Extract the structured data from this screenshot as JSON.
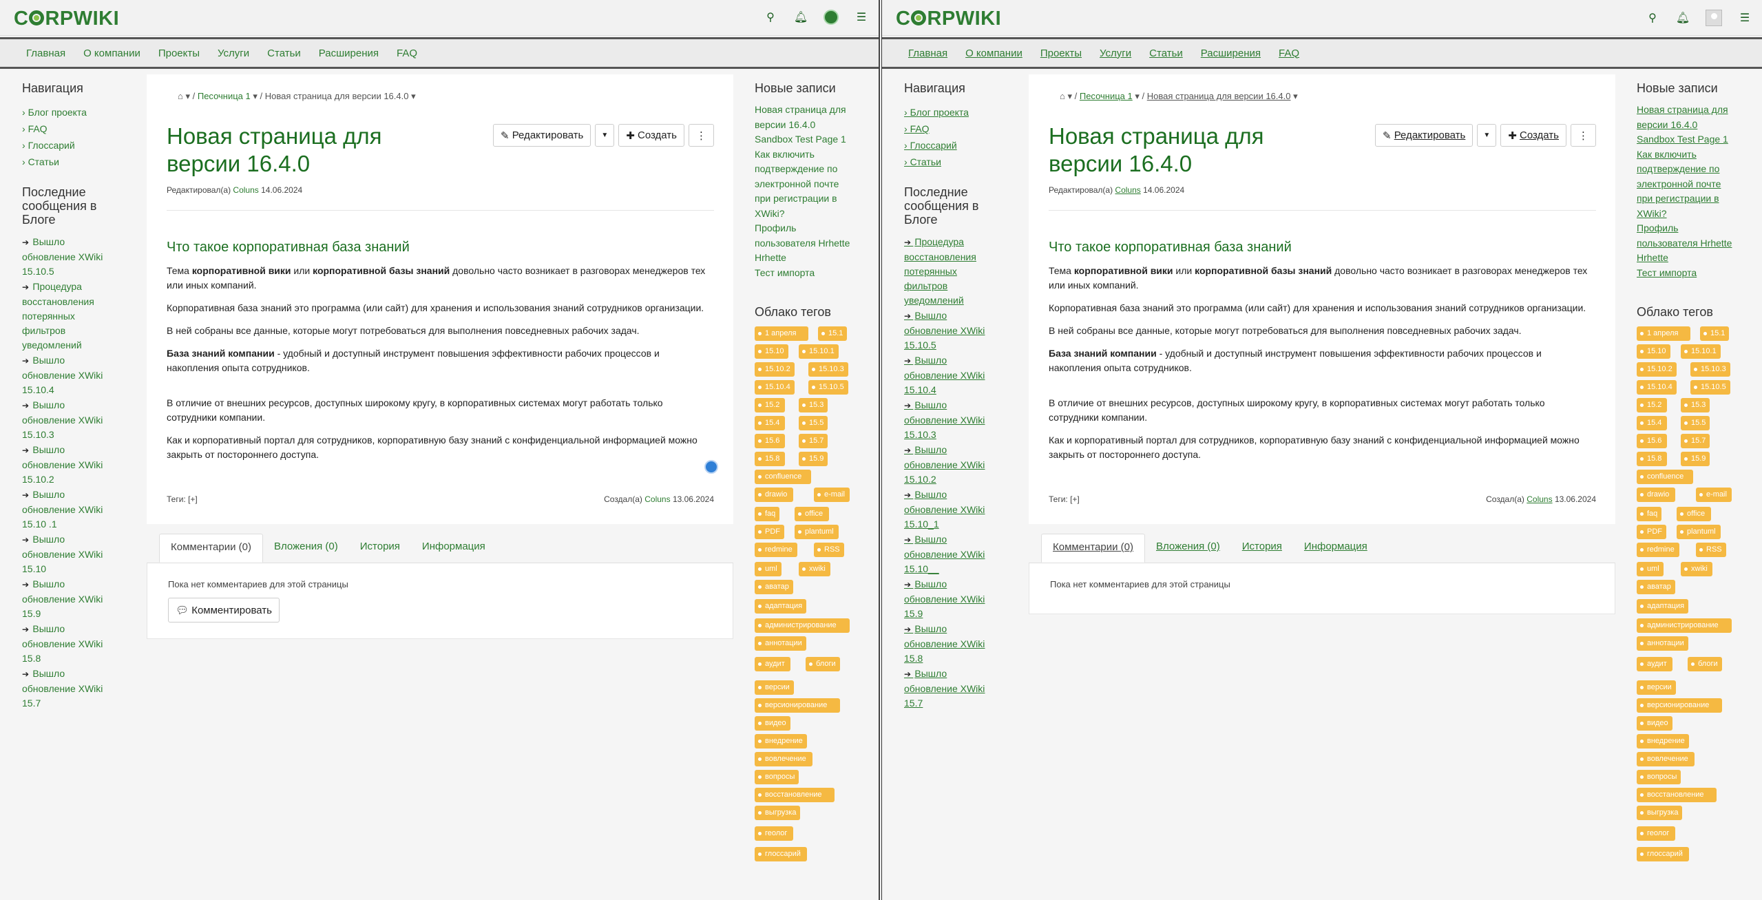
{
  "app": {
    "logo": "CORPWIKI"
  },
  "menu": [
    "Главная",
    "О компании",
    "Проекты",
    "Услуги",
    "Статьи",
    "Расширения",
    "FAQ"
  ],
  "navigation": {
    "title": "Навигация",
    "items": [
      "Блог проекта",
      "FAQ",
      "Глоссарий",
      "Статьи"
    ]
  },
  "blog": {
    "title": "Последние сообщения в Блоге",
    "left_items": [
      [
        "Вышло",
        "обновление XWiki",
        "15.10.5"
      ],
      [
        "Процедура",
        "восстановления",
        "потерянных",
        "фильтров",
        "уведомлений"
      ],
      [
        "Вышло",
        "обновление XWiki",
        "15.10.4"
      ],
      [
        "Вышло",
        "обновление XWiki",
        "15.10.3"
      ],
      [
        "Вышло",
        "обновление XWiki",
        "15.10.2"
      ],
      [
        "Вышло",
        "обновление XWiki",
        "15.10 .1"
      ],
      [
        "Вышло",
        "обновление XWiki",
        "15.10"
      ],
      [
        "Вышло",
        "обновление XWiki",
        "15.9"
      ],
      [
        "Вышло",
        "обновление XWiki",
        "15.8"
      ],
      [
        "Вышло",
        "обновление XWiki",
        "15.7"
      ]
    ],
    "right_items": [
      [
        "Процедура",
        "восстановления",
        "потерянных",
        "фильтров",
        "уведомлений"
      ],
      [
        "Вышло",
        "обновление XWiki",
        "15.10.5"
      ],
      [
        "Вышло",
        "обновление XWiki",
        "15.10.4"
      ],
      [
        "Вышло",
        "обновление XWiki",
        "15.10.3"
      ],
      [
        "Вышло",
        "обновление XWiki",
        "15.10.2"
      ],
      [
        "Вышло",
        "обновление XWiki",
        "15.10_1"
      ],
      [
        "Вышло",
        "обновление XWiki",
        "15.10__"
      ],
      [
        "Вышло",
        "обновление XWiki",
        "15.9"
      ],
      [
        "Вышло",
        "обновление XWiki",
        "15.8"
      ],
      [
        "Вышло",
        "обновление XWiki",
        "15.7"
      ]
    ]
  },
  "breadcrumb": {
    "sandbox": "Песочница 1",
    "current": "Новая страница для версии 16.4.0"
  },
  "page": {
    "title_line1": "Новая страница для",
    "title_line2": "версии 16.4.0",
    "edit_label": "Редактировать",
    "create_label": "Создать",
    "edited_by_prefix": "Редактировал(а)",
    "edited_by_user": "Coluns",
    "edited_date": "14.06.2024",
    "heading": "Что такое корпоративная база знаний",
    "p1_a": "Тема ",
    "p1_b": "корпоративной вики",
    "p1_c": " или ",
    "p1_d": "корпоративной базы знаний",
    "p1_e": " довольно часто возникает в разговорах менеджеров тех или иных компаний.",
    "p2": "Корпоративная база знаний это программа (или сайт) для хранения и использования знаний сотрудников организации.",
    "p3": "В ней собраны все данные, которые могут потребоваться для выполнения повседневных рабочих задач.",
    "p4_a": "База знаний компании",
    "p4_b": " - удобный и доступный инструмент повышения эффективности рабочих процессов и накопления опыта сотрудников.",
    "p5": "В отличие от внешних ресурсов, доступных широкому кругу, в корпоративных системах могут работать только сотрудники компании.",
    "p6": "Как и корпоративный портал для сотрудников, корпоративную базу знаний с конфиденциальной информацией можно закрыть от постороннего доступа.",
    "tags_label": "Теги:",
    "tags_add": "[+]",
    "created_prefix": "Создал(а)",
    "created_user": "Coluns",
    "created_date": "13.06.2024"
  },
  "tabs": [
    "Комментарии (0)",
    "Вложения (0)",
    "История",
    "Информация"
  ],
  "comments": {
    "empty": "Пока нет комментариев для этой страницы",
    "button": "Комментировать"
  },
  "recent": {
    "title": "Новые записи",
    "lines": [
      "Новая страница для",
      "версии 16.4.0",
      "Sandbox Test Page 1",
      "Как включить",
      "подтверждение по",
      "электронной почте",
      "при регистрации в",
      "XWiki?",
      "Профиль",
      "пользователя Hrhette",
      "Hrhette",
      "Тест импорта"
    ]
  },
  "tagcloud": {
    "title": "Облако тегов",
    "tags": [
      [
        "1 апреля",
        0,
        0,
        78
      ],
      [
        "15.1",
        92,
        0,
        38
      ],
      [
        "15.10",
        0,
        26,
        44
      ],
      [
        "15.10.1",
        64,
        26,
        54
      ],
      [
        "15.10.2",
        0,
        52,
        58
      ],
      [
        "15.10.3",
        78,
        52,
        54
      ],
      [
        "15.10.4",
        0,
        78,
        58
      ],
      [
        "15.10.5",
        78,
        78,
        56
      ],
      [
        "15.2",
        0,
        104,
        44
      ],
      [
        "15.3",
        64,
        104,
        38
      ],
      [
        "15.4",
        0,
        130,
        44
      ],
      [
        "15.5",
        64,
        130,
        38
      ],
      [
        "15.6",
        0,
        156,
        44
      ],
      [
        "15.7",
        64,
        156,
        38
      ],
      [
        "15.8",
        0,
        182,
        44
      ],
      [
        "15.9",
        64,
        182,
        38
      ],
      [
        "confluence",
        0,
        208,
        82
      ],
      [
        "drawio",
        0,
        234,
        56
      ],
      [
        "e-mail",
        86,
        234,
        52
      ],
      [
        "faq",
        0,
        262,
        36
      ],
      [
        "office",
        58,
        262,
        50
      ],
      [
        "PDF",
        0,
        288,
        36
      ],
      [
        "plantuml",
        58,
        288,
        64
      ],
      [
        "redmine",
        0,
        314,
        62
      ],
      [
        "RSS",
        86,
        314,
        36
      ],
      [
        "uml",
        0,
        342,
        36
      ],
      [
        "xwiki",
        64,
        342,
        46
      ],
      [
        "аватар",
        0,
        368,
        56
      ],
      [
        "адаптация",
        0,
        396,
        72
      ],
      [
        "администрирование",
        0,
        424,
        138
      ],
      [
        "аннотации",
        0,
        450,
        74
      ],
      [
        "аудит",
        0,
        480,
        52
      ],
      [
        "блоги",
        74,
        480,
        48
      ],
      [
        "версии",
        0,
        514,
        56
      ],
      [
        "версионирование",
        0,
        540,
        124
      ],
      [
        "видео",
        0,
        566,
        50
      ],
      [
        "внедрение",
        0,
        592,
        74
      ],
      [
        "вовлечение",
        0,
        618,
        84
      ],
      [
        "вопросы",
        0,
        644,
        64
      ],
      [
        "восстановление",
        0,
        670,
        116
      ],
      [
        "выгрузка",
        0,
        696,
        66
      ],
      [
        "геолог",
        0,
        726,
        56
      ],
      [
        "глоссарий",
        0,
        756,
        76
      ]
    ]
  }
}
